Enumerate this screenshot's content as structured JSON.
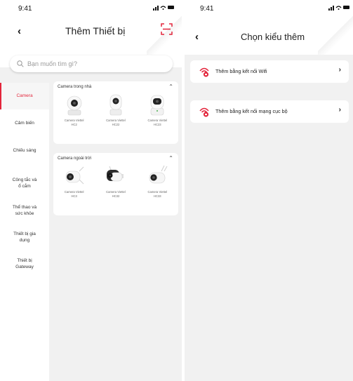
{
  "status": {
    "time": "9:41",
    "icons": "signal-wifi-battery"
  },
  "colors": {
    "accent": "#e3253b"
  },
  "left_screen": {
    "header": {
      "back_label": "‹",
      "title": "Thêm Thiết bị",
      "scan_icon": "qr-scan-icon"
    },
    "search": {
      "placeholder": "Bạn muốn tìm gì?",
      "value": ""
    },
    "sidebar": {
      "items": [
        {
          "label": "Camera",
          "active": true
        },
        {
          "label": "Cảm biến",
          "active": false
        },
        {
          "label": "Chiếu sáng",
          "active": false
        },
        {
          "label": "Công tắc và\nổ cắm",
          "active": false
        },
        {
          "label": "Thể thao và\nsức khỏe",
          "active": false
        },
        {
          "label": "Thiết bị gia\ndụng",
          "active": false
        },
        {
          "label": "Thiết bị\nGateway",
          "active": false
        }
      ]
    },
    "groups": [
      {
        "title": "Camera trong nhà",
        "products": [
          {
            "name": "Camera Viettel\nHC2",
            "icon": "indoor-camera-icon"
          },
          {
            "name": "Camera Viettel\nHC22",
            "icon": "indoor-camera-icon"
          },
          {
            "name": "Camera Viettel\nHC23",
            "icon": "indoor-camera-icon"
          }
        ]
      },
      {
        "title": "Camera ngoài trời",
        "products": [
          {
            "name": "Camera Viettel\nHC3",
            "icon": "outdoor-camera-icon"
          },
          {
            "name": "Camera Viettel\nHC32",
            "icon": "outdoor-camera-icon"
          },
          {
            "name": "Camera Viettel\nHC33",
            "icon": "outdoor-camera-icon"
          }
        ]
      }
    ]
  },
  "right_screen": {
    "header": {
      "back_label": "‹",
      "title": "Chọn kiểu thêm"
    },
    "options": [
      {
        "label": "Thêm bằng kết nối Wifi",
        "icon": "wifi-connect-icon",
        "arrow": "›"
      },
      {
        "label": "Thêm bằng kết nối mạng cục bộ",
        "icon": "lan-connect-icon",
        "arrow": "›"
      }
    ]
  }
}
